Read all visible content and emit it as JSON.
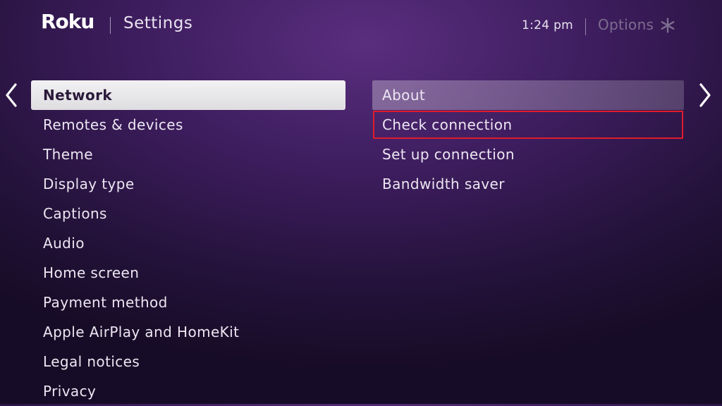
{
  "header": {
    "logo_text": "Roku",
    "title": "Settings",
    "time": "1:24  pm",
    "options_label": "Options"
  },
  "icons": {
    "options": "asterisk-icon",
    "left_nav": "chevron-left-icon",
    "right_nav": "chevron-right-icon"
  },
  "colors": {
    "selected_bg": "#efeef1",
    "highlight_outline": "#e01b2c",
    "options_text": "#7d6d8f"
  },
  "menu": {
    "items": [
      {
        "label": "Network",
        "selected": true
      },
      {
        "label": "Remotes & devices"
      },
      {
        "label": "Theme"
      },
      {
        "label": "Display type"
      },
      {
        "label": "Captions"
      },
      {
        "label": "Audio"
      },
      {
        "label": "Home screen"
      },
      {
        "label": "Payment method"
      },
      {
        "label": "Apple AirPlay and HomeKit"
      },
      {
        "label": "Legal notices"
      },
      {
        "label": "Privacy"
      }
    ]
  },
  "submenu": {
    "items": [
      {
        "label": "About",
        "active": true
      },
      {
        "label": "Check connection",
        "highlighted": true
      },
      {
        "label": "Set up connection"
      },
      {
        "label": "Bandwidth saver"
      }
    ]
  }
}
